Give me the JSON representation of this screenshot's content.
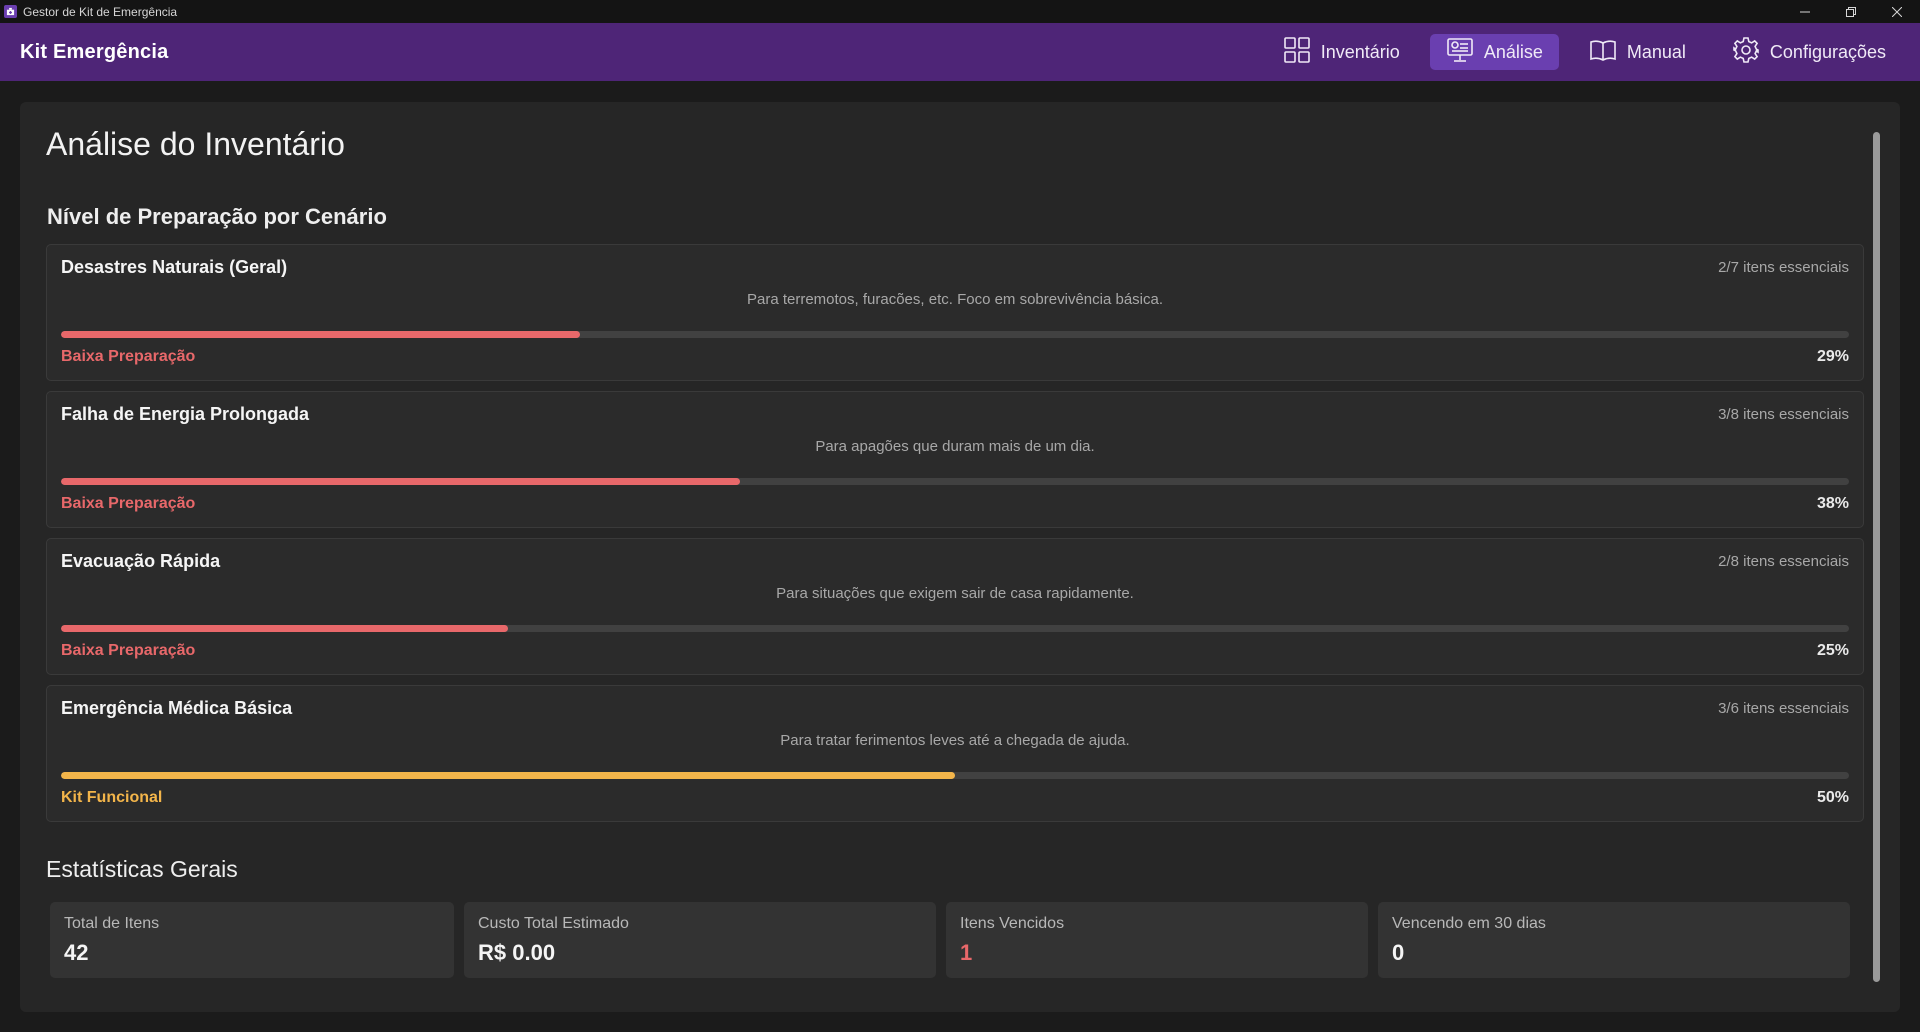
{
  "window": {
    "title": "Gestor de Kit de Emergência"
  },
  "header": {
    "brand": "Kit Emergência",
    "nav": [
      {
        "label": "Inventário",
        "icon": "grid-icon",
        "active": false
      },
      {
        "label": "Análise",
        "icon": "monitor-chart-icon",
        "active": true
      },
      {
        "label": "Manual",
        "icon": "book-icon",
        "active": false
      },
      {
        "label": "Configurações",
        "icon": "gear-icon",
        "active": false
      }
    ]
  },
  "main": {
    "title": "Análise do Inventário",
    "scenarios_title": "Nível de Preparação por Cenário",
    "scenarios": [
      {
        "title": "Desastres Naturais (Geral)",
        "count": "2/7 itens essenciais",
        "description": "Para terremotos, furacões, etc. Foco em sobrevivência básica.",
        "progress": 0.29,
        "status": "Baixa Preparação",
        "percent": "29%",
        "color": "#e8686a"
      },
      {
        "title": "Falha de Energia Prolongada",
        "count": "3/8 itens essenciais",
        "description": "Para apagões que duram mais de um dia.",
        "progress": 0.38,
        "status": "Baixa Preparação",
        "percent": "38%",
        "color": "#e8686a"
      },
      {
        "title": "Evacuação Rápida",
        "count": "2/8 itens essenciais",
        "description": "Para situações que exigem sair de casa rapidamente.",
        "progress": 0.25,
        "status": "Baixa Preparação",
        "percent": "25%",
        "color": "#e8686a"
      },
      {
        "title": "Emergência Médica Básica",
        "count": "3/6 itens essenciais",
        "description": "Para tratar ferimentos leves até a chegada de ajuda.",
        "progress": 0.5,
        "status": "Kit Funcional",
        "percent": "50%",
        "color": "#f3b54a"
      }
    ],
    "stats_title": "Estatísticas Gerais",
    "stats": [
      {
        "label": "Total de Itens",
        "value": "42",
        "color": "#f5f5f5"
      },
      {
        "label": "Custo Total Estimado",
        "value": "R$ 0.00",
        "color": "#f5f5f5"
      },
      {
        "label": "Itens Vencidos",
        "value": "1",
        "color": "#e8686a"
      },
      {
        "label": "Vencendo em 30 dias",
        "value": "0",
        "color": "#f5f5f5"
      }
    ]
  },
  "colors": {
    "header_bg": "#4e2577",
    "nav_active_bg": "#6a3fb0",
    "danger": "#e8686a",
    "warning": "#f3b54a"
  }
}
